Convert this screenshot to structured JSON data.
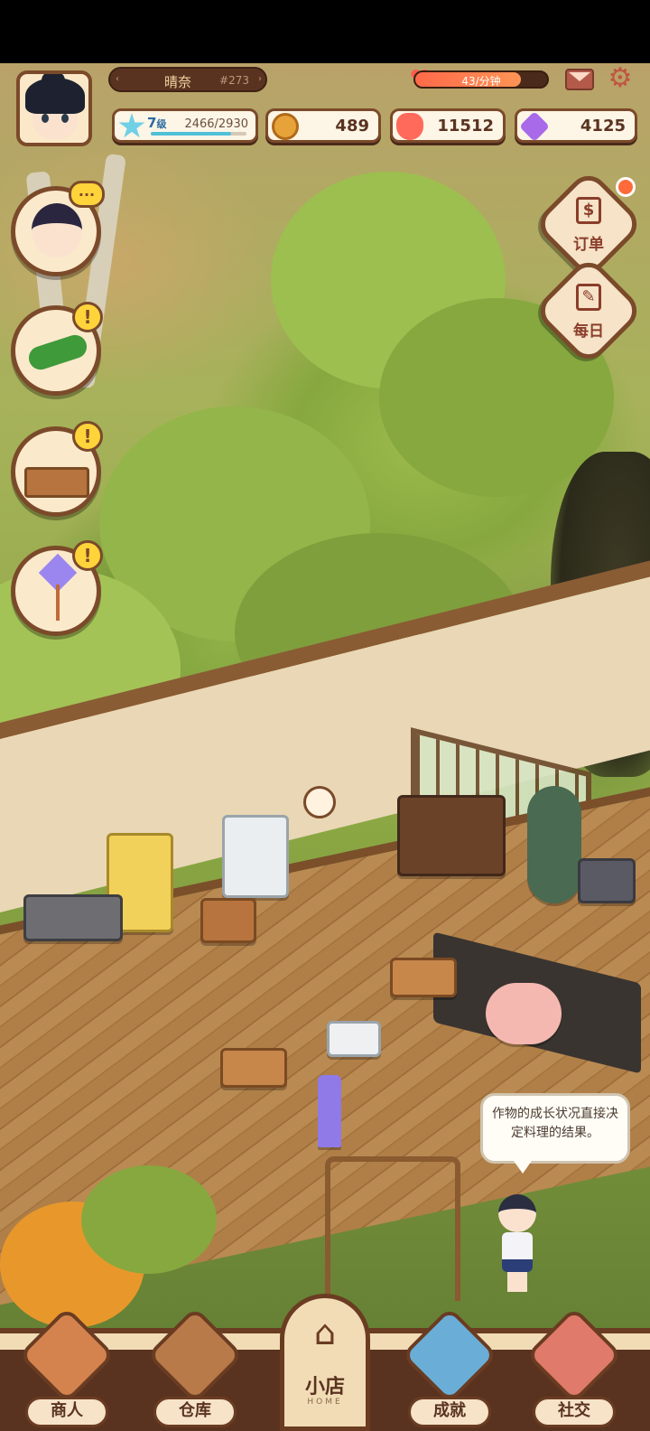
{
  "player": {
    "name": "晴奈",
    "uid": "#273"
  },
  "energy": {
    "rate_text": "43/分钟",
    "fill_percent": 80
  },
  "stats": {
    "level": "7",
    "level_unit": "级",
    "exp_text": "2466/2930",
    "exp_progress": 0.84,
    "coins": "489",
    "hearts": "11512",
    "gems": "4125"
  },
  "side_buttons": {
    "orders": "订单",
    "daily": "每日"
  },
  "task_bubbles": [
    {
      "icon": "chat-npc-icon",
      "badge": "..."
    },
    {
      "icon": "cucumber-icon",
      "badge": "!"
    },
    {
      "icon": "stove-table-icon",
      "badge": "!"
    },
    {
      "icon": "lamp-icon",
      "badge": "!"
    }
  ],
  "speech": {
    "text": "作物的成长状况直接决定料理的结果。"
  },
  "nav": {
    "merchant": "商人",
    "warehouse": "仓库",
    "home": "小店",
    "home_sub": "HOME",
    "achievement": "成就",
    "social": "社交"
  },
  "colors": {
    "frame_brown": "#7b4a2a",
    "energy_red": "#ff6a4a",
    "alert_yellow": "#ffd43b",
    "exp_blue": "#4fc0d8"
  }
}
